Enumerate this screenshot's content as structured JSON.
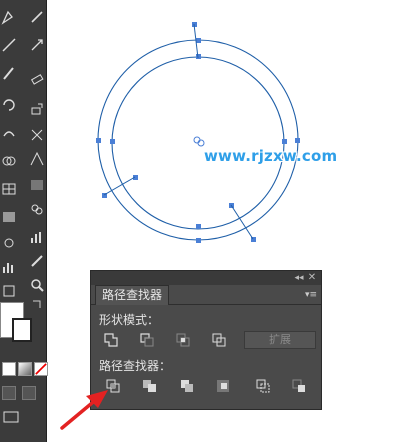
{
  "canvas": {
    "watermark": "www.rjzxw.com"
  },
  "pathfinder_panel": {
    "tab_title": "路径查找器",
    "collapse_icon": "double-chevron-right-icon",
    "close_icon": "close-icon",
    "menu_icon": "panel-menu-icon",
    "shape_modes_label": "形状模式：",
    "shape_modes": [
      {
        "name": "unite",
        "icon": "unite-icon"
      },
      {
        "name": "minus-front",
        "icon": "minus-front-icon"
      },
      {
        "name": "intersect",
        "icon": "intersect-icon"
      },
      {
        "name": "exclude",
        "icon": "exclude-icon"
      }
    ],
    "expand_label": "扩展",
    "pathfinders_label": "路径查找器：",
    "pathfinders": [
      {
        "name": "divide",
        "icon": "divide-icon"
      },
      {
        "name": "trim",
        "icon": "trim-icon"
      },
      {
        "name": "merge",
        "icon": "merge-icon"
      },
      {
        "name": "crop",
        "icon": "crop-icon"
      },
      {
        "name": "outline",
        "icon": "outline-icon"
      },
      {
        "name": "minus-back",
        "icon": "minus-back-icon"
      }
    ]
  },
  "colors": {
    "path_blue": "#4a7fd6",
    "stroke": "#1f5fa8",
    "panel_bg": "#4a4a4a",
    "toolbar_bg": "#3b3b3b",
    "annotation_red": "#e32222"
  }
}
